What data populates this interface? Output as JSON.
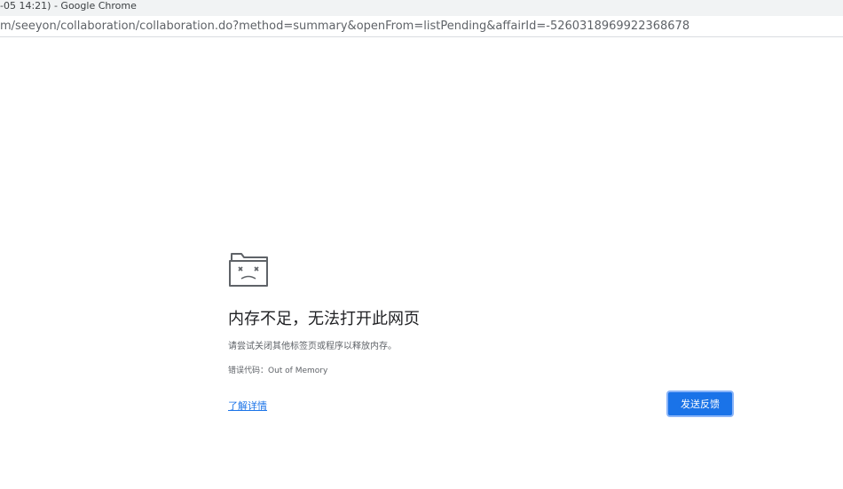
{
  "window": {
    "title": "-05 14:21) - Google Chrome"
  },
  "address_bar": {
    "url": "m/seeyon/collaboration/collaboration.do?method=summary&openFrom=listPending&affairId=-5260318969922368678"
  },
  "error_page": {
    "icon": "sad-folder-icon",
    "title": "内存不足，无法打开此网页",
    "description": "请尝试关闭其他标签页或程序以释放内存。",
    "error_code": "错误代码：Out of Memory",
    "details_link": "了解详情",
    "feedback_button": "发送反馈"
  },
  "colors": {
    "link": "#1a73e8",
    "button": "#1a73e8",
    "text": "#202124",
    "secondary_text": "#5f6368"
  }
}
